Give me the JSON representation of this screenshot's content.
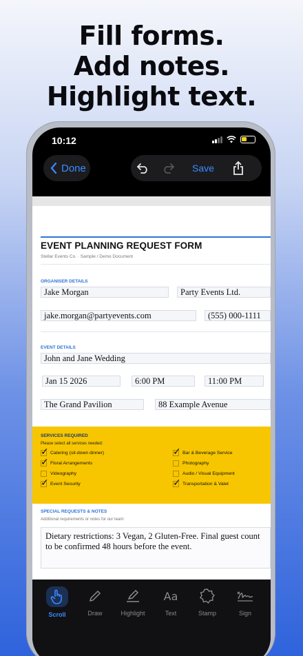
{
  "headline": [
    "Fill forms.",
    "Add notes.",
    "Highlight text."
  ],
  "status": {
    "time": "10:12"
  },
  "nav": {
    "done_label": "Done",
    "save_label": "Save"
  },
  "form": {
    "title": "EVENT PLANNING REQUEST FORM",
    "subtitle": "Stellar Events Co.  ·  Sample / Demo Document",
    "organiser": {
      "label": "ORGANISER DETAILS",
      "name": "Jake Morgan",
      "company": "Party Events Ltd.",
      "email": "jake.morgan@partyevents.com",
      "phone": "(555) 000-1111"
    },
    "event": {
      "label": "EVENT DETAILS",
      "name": "John and Jane Wedding",
      "date": "Jan 15 2026",
      "start": "6:00 PM",
      "end": "11:00 PM",
      "venue": "The Grand Pavilion",
      "address": "88 Example Avenue"
    },
    "services": {
      "label": "SERVICES REQUIRED",
      "hint": "Please select all services needed:",
      "items": [
        {
          "label": "Catering (sit-down dinner)",
          "checked": true
        },
        {
          "label": "Bar & Beverage Service",
          "checked": true
        },
        {
          "label": "Floral Arrangements",
          "checked": true
        },
        {
          "label": "Photography",
          "checked": false
        },
        {
          "label": "Videography",
          "checked": false
        },
        {
          "label": "Audio / Visual Equipment",
          "checked": false
        },
        {
          "label": "Event Security",
          "checked": true
        },
        {
          "label": "Transportation & Valet",
          "checked": true
        }
      ]
    },
    "notes": {
      "label": "SPECIAL REQUESTS & NOTES",
      "hint": "Additional requirements or notes for our team:",
      "text": "Dietary restrictions: 3 Vegan, 2 Gluten-Free. Final guest count to be confirmed 48 hours before the event."
    }
  },
  "toolbar": {
    "tools": [
      {
        "label": "Scroll",
        "icon": "hand-pointer-icon",
        "active": true
      },
      {
        "label": "Draw",
        "icon": "pencil-icon",
        "active": false
      },
      {
        "label": "Highlight",
        "icon": "highlighter-icon",
        "active": false
      },
      {
        "label": "Text",
        "icon": "text-aa-icon",
        "active": false
      },
      {
        "label": "Stamp",
        "icon": "stamp-icon",
        "active": false
      },
      {
        "label": "Sign",
        "icon": "signature-icon",
        "active": false
      }
    ],
    "accent": "#3b8bff"
  },
  "colors": {
    "services_bg": "#f7c600",
    "section_blue": "#2f73d6"
  }
}
